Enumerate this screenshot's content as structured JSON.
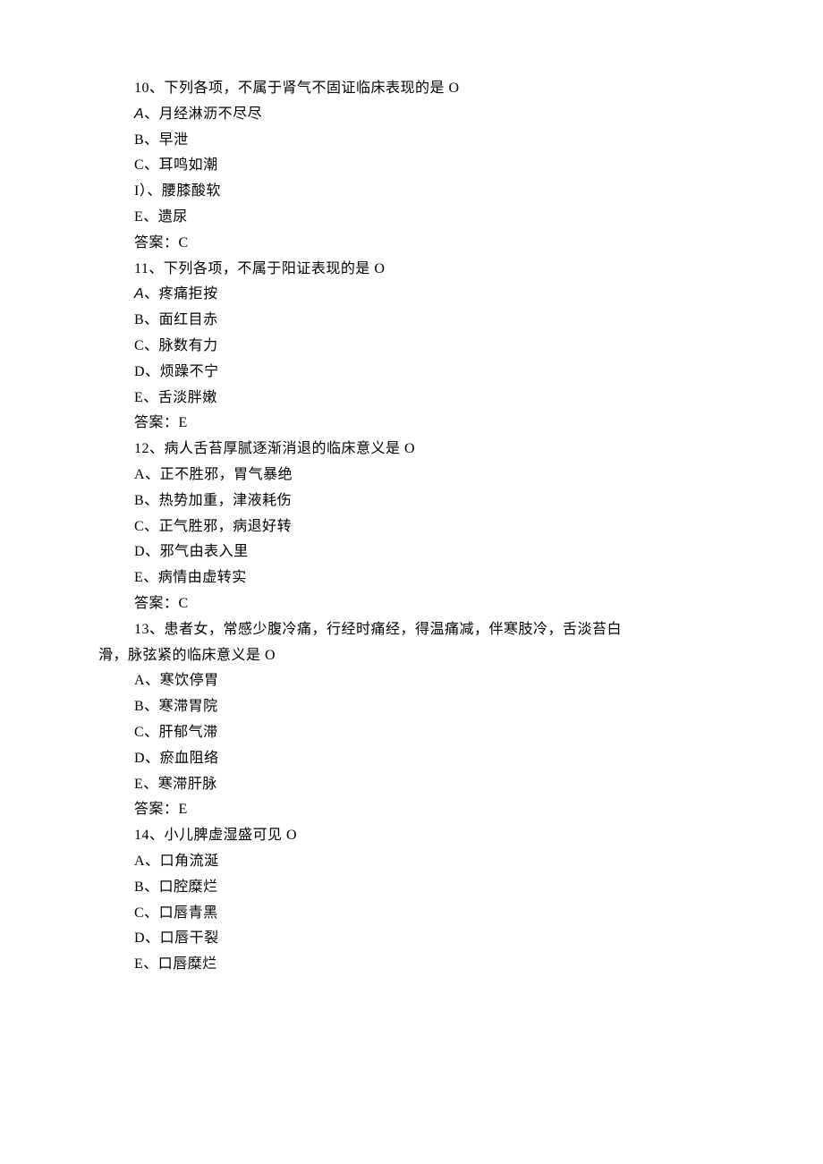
{
  "questions": [
    {
      "num": "10",
      "stem": "、下列各项，不属于肾气不固证临床表现的是 O",
      "options": [
        {
          "letter": "A",
          "text": "、月经淋沥不尽尽",
          "italicA": true
        },
        {
          "letter": "B",
          "text": "、早泄"
        },
        {
          "letter": "C",
          "text": "、耳鸣如潮"
        },
        {
          "letter": "I）",
          "text": "、腰膝酸软"
        },
        {
          "letter": "E",
          "text": "、遗尿"
        }
      ],
      "answer": "答案：C"
    },
    {
      "num": "11",
      "stem": "、下列各项，不属于阳证表现的是 O",
      "options": [
        {
          "letter": "A",
          "text": "、疼痛拒按",
          "italicA": true
        },
        {
          "letter": "B",
          "text": "、面红目赤"
        },
        {
          "letter": "C",
          "text": "、脉数有力"
        },
        {
          "letter": "D",
          "text": "、烦躁不宁"
        },
        {
          "letter": "E",
          "text": "、舌淡胖嫩"
        }
      ],
      "answer": "答案：E"
    },
    {
      "num": "12",
      "stem": "、病人舌苔厚腻逐渐消退的临床意义是 O",
      "options": [
        {
          "letter": "A",
          "text": "、正不胜邪，胃气暴绝"
        },
        {
          "letter": "B",
          "text": "、热势加重，津液耗伤"
        },
        {
          "letter": "C",
          "text": "、正气胜邪，病退好转"
        },
        {
          "letter": "D",
          "text": "、邪气由表入里"
        },
        {
          "letter": "E",
          "text": "、病情由虚转实"
        }
      ],
      "answer": "答案：C"
    },
    {
      "num": "13",
      "stem": "、患者女，常感少腹冷痛，行经时痛经，得温痛减，伴寒肢冷，舌淡苔白",
      "stem2": "滑，脉弦紧的临床意义是 O",
      "options": [
        {
          "letter": "A",
          "text": "、寒饮停胃"
        },
        {
          "letter": "B",
          "text": "、寒滞胃院"
        },
        {
          "letter": "C",
          "text": "、肝郁气滞"
        },
        {
          "letter": "D",
          "text": "、瘀血阻络"
        },
        {
          "letter": "E",
          "text": "、寒滞肝脉"
        }
      ],
      "answer": "答案：E"
    },
    {
      "num": "14",
      "stem": "、小儿脾虚湿盛可见 O",
      "options": [
        {
          "letter": "A",
          "text": "、口角流涎"
        },
        {
          "letter": "B",
          "text": "、口腔糜烂"
        },
        {
          "letter": "C",
          "text": "、口唇青黑"
        },
        {
          "letter": "D",
          "text": "、口唇干裂"
        },
        {
          "letter": "E",
          "text": "、口唇糜烂"
        }
      ],
      "answer": ""
    }
  ]
}
